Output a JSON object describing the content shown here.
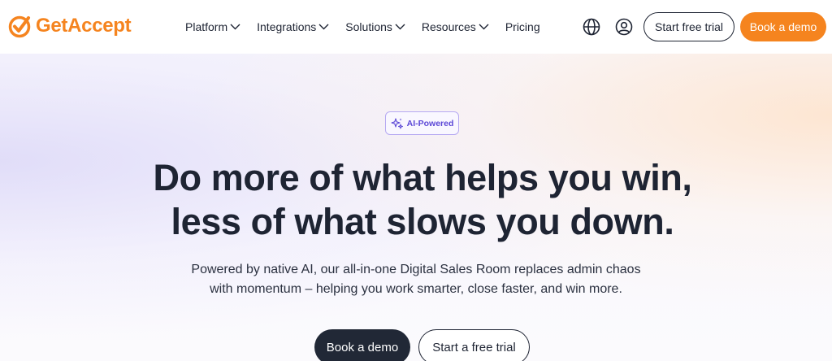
{
  "brand": {
    "name": "GetAccept",
    "color": "#f5841f"
  },
  "nav": {
    "items": [
      {
        "label": "Platform",
        "has_dropdown": true
      },
      {
        "label": "Integrations",
        "has_dropdown": true
      },
      {
        "label": "Solutions",
        "has_dropdown": true
      },
      {
        "label": "Resources",
        "has_dropdown": true
      },
      {
        "label": "Pricing",
        "has_dropdown": false
      }
    ],
    "icons": [
      "globe-icon",
      "user-icon"
    ],
    "trial_button": "Start free trial",
    "demo_button": "Book a demo"
  },
  "hero": {
    "badge": "AI-Powered",
    "headline_line1": "Do more of what helps you win,",
    "headline_line2": "less of what slows you down.",
    "subtext_line1": "Powered by native AI, our all-in-one Digital Sales Room replaces admin chaos",
    "subtext_line2": "with momentum – helping you work smarter, close faster, and win more.",
    "primary_cta": "Book a demo",
    "secondary_cta": "Start a free trial"
  },
  "colors": {
    "accent": "#f5841f",
    "dark": "#1e2433",
    "badge_purple": "#5b47d6"
  }
}
